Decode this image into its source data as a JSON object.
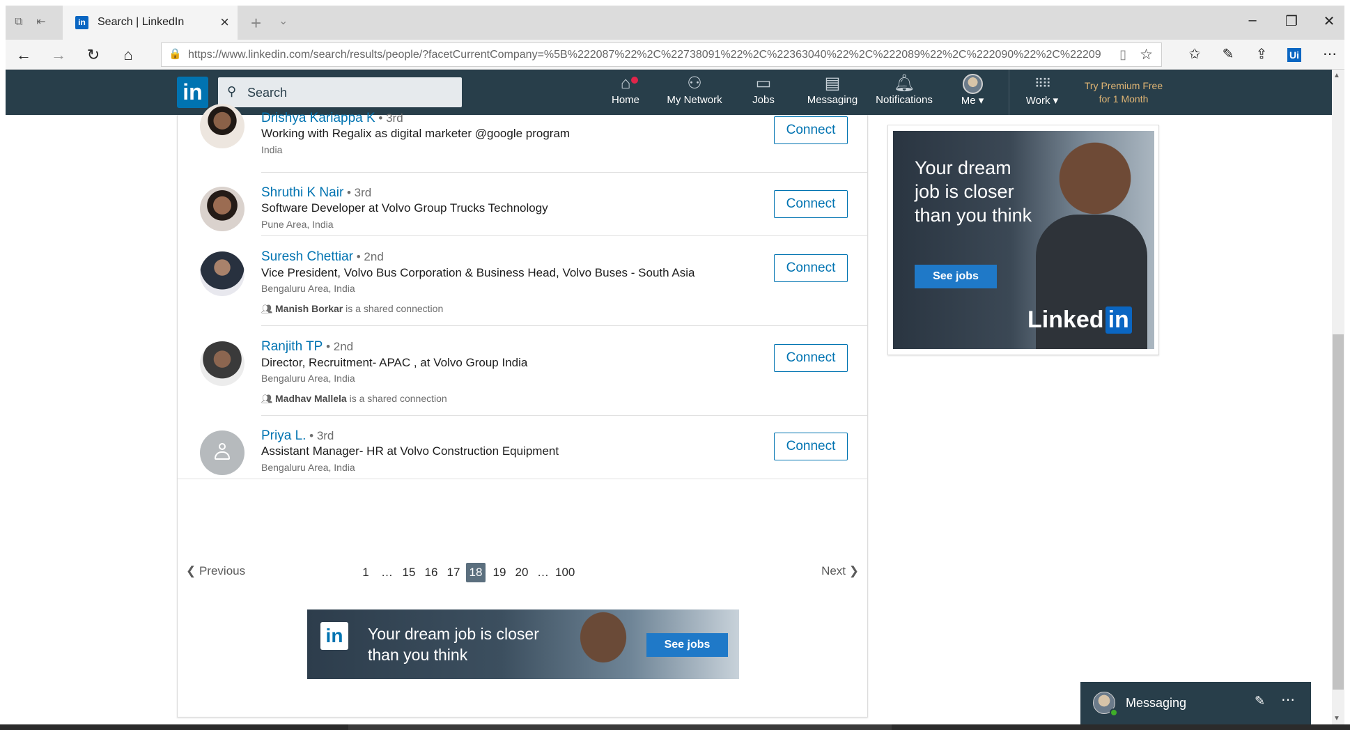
{
  "browser": {
    "tab_title": "Search | LinkedIn",
    "url": "https://www.linkedin.com/search/results/people/?facetCurrentCompany=%5B%222087%22%2C%22738091%22%2C%22363040%22%2C%222089%22%2C%222090%22%2C%22209",
    "minimize": "–",
    "restore": "❐",
    "close": "✕"
  },
  "header": {
    "logo": "in",
    "search_placeholder": "Search",
    "nav": [
      {
        "label": "Home",
        "icon": "home-icon",
        "glyph": "⌂"
      },
      {
        "label": "My Network",
        "icon": "network-icon",
        "glyph": "👥"
      },
      {
        "label": "Jobs",
        "icon": "jobs-icon",
        "glyph": "💼"
      },
      {
        "label": "Messaging",
        "icon": "messaging-icon",
        "glyph": "💬"
      },
      {
        "label": "Notifications",
        "icon": "bell-icon",
        "glyph": "🔔"
      },
      {
        "label": "Me ▾",
        "icon": "avatar",
        "glyph": ""
      },
      {
        "label": "Work ▾",
        "icon": "grid-icon",
        "glyph": "⋮⋮⋮"
      }
    ],
    "premium_line1": "Try Premium Free",
    "premium_line2": "for 1 Month"
  },
  "results": [
    {
      "name": "Drishya Kariappa K",
      "degree": " • 3rd",
      "headline": "Working with Regalix as digital marketer @google program",
      "location": "India",
      "shared_name": "",
      "shared_text": "",
      "action": "Connect"
    },
    {
      "name": "Shruthi K Nair",
      "degree": " • 3rd",
      "headline": "Software Developer at Volvo Group Trucks Technology",
      "location": "Pune Area, India",
      "shared_name": "",
      "shared_text": "",
      "action": "Connect"
    },
    {
      "name": "Suresh Chettiar",
      "degree": " • 2nd",
      "headline": "Vice President, Volvo Bus Corporation & Business Head, Volvo Buses - South Asia",
      "location": "Bengaluru Area, India",
      "shared_name": "Manish Borkar",
      "shared_text": " is a shared connection",
      "action": "Connect"
    },
    {
      "name": "Ranjith TP",
      "degree": " • 2nd",
      "headline": "Director, Recruitment- APAC , at Volvo Group India",
      "location": "Bengaluru Area, India",
      "shared_name": "Madhav Mallela",
      "shared_text": " is a shared connection",
      "action": "Connect"
    },
    {
      "name": "Priya L.",
      "degree": " • 3rd",
      "headline": "Assistant Manager- HR at Volvo Construction Equipment",
      "location": "Bengaluru Area, India",
      "shared_name": "",
      "shared_text": "",
      "action": "Connect"
    }
  ],
  "pagination": {
    "previous": "Previous",
    "next": "Next",
    "pages": [
      "1",
      "…",
      "15",
      "16",
      "17",
      "18",
      "19",
      "20",
      "…",
      "100"
    ],
    "current": "18"
  },
  "ads": {
    "bottom_text": "Your dream job is closer than you think",
    "bottom_button": "See jobs",
    "side_text": "Your dream job is closer than you think",
    "side_button": "See jobs",
    "side_brand": "Linked",
    "side_brand_box": "in"
  },
  "messaging": {
    "title": "Messaging"
  }
}
